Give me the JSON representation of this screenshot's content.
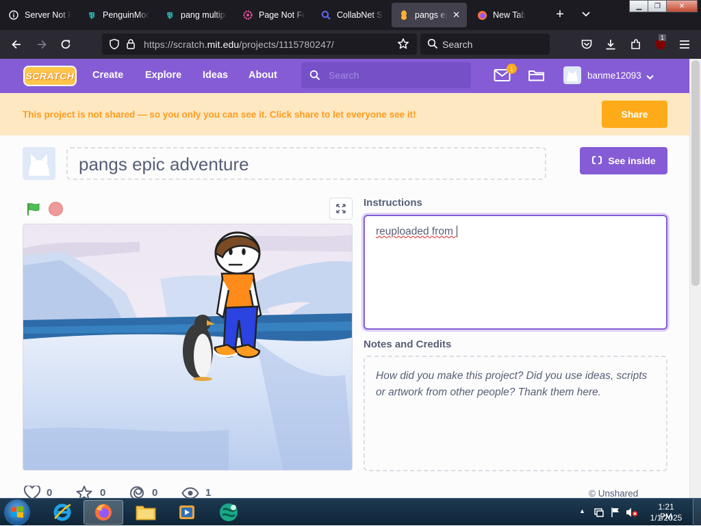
{
  "browser": {
    "tabs": [
      {
        "title": "Server Not Fo",
        "icon": "info-icon"
      },
      {
        "title": "PenguinMod",
        "icon": "penguinmod-icon"
      },
      {
        "title": "pang multipl",
        "icon": "penguinmod-icon"
      },
      {
        "title": "Page Not Fou",
        "icon": "flower-icon"
      },
      {
        "title": "CollabNet Se",
        "icon": "search-magnifier-icon"
      },
      {
        "title": "pangs epic",
        "icon": "scratch-icon",
        "active": true
      },
      {
        "title": "New Tab",
        "icon": "firefox-icon"
      }
    ],
    "url_prefix": "https://scratch.",
    "url_domain": "mit.edu",
    "url_path": "/projects/1115780247/",
    "search_placeholder": "Search",
    "extension_badge": "1"
  },
  "scratch": {
    "logo": "SCRATCH",
    "nav": [
      "Create",
      "Explore",
      "Ideas",
      "About"
    ],
    "search_placeholder": "Search",
    "messages_count": "1",
    "username": "banme12093",
    "banner_text": "This project is not shared — so you only you can see it. Click share to let everyone see it!",
    "share_label": "Share",
    "project_title": "pangs epic adventure",
    "see_inside_label": "See inside",
    "instructions_label": "Instructions",
    "instructions_text": "reuploaded from ",
    "notes_label": "Notes and Credits",
    "notes_placeholder": "How did you make this project? Did you use ideas, scripts or artwork from other people? Thank them here.",
    "stats": {
      "loves": "0",
      "favorites": "0",
      "remixes": "0",
      "views": "1"
    },
    "unshared_label": "Unshared"
  },
  "taskbar": {
    "time": "1:21 PM",
    "date": "1/1/2025"
  },
  "colors": {
    "scratch_purple": "#855cd6",
    "banner_bg": "#fde8c2",
    "banner_text": "#ff9b1e",
    "share_orange": "#ffab19",
    "browser_dark": "#1c1b22"
  }
}
